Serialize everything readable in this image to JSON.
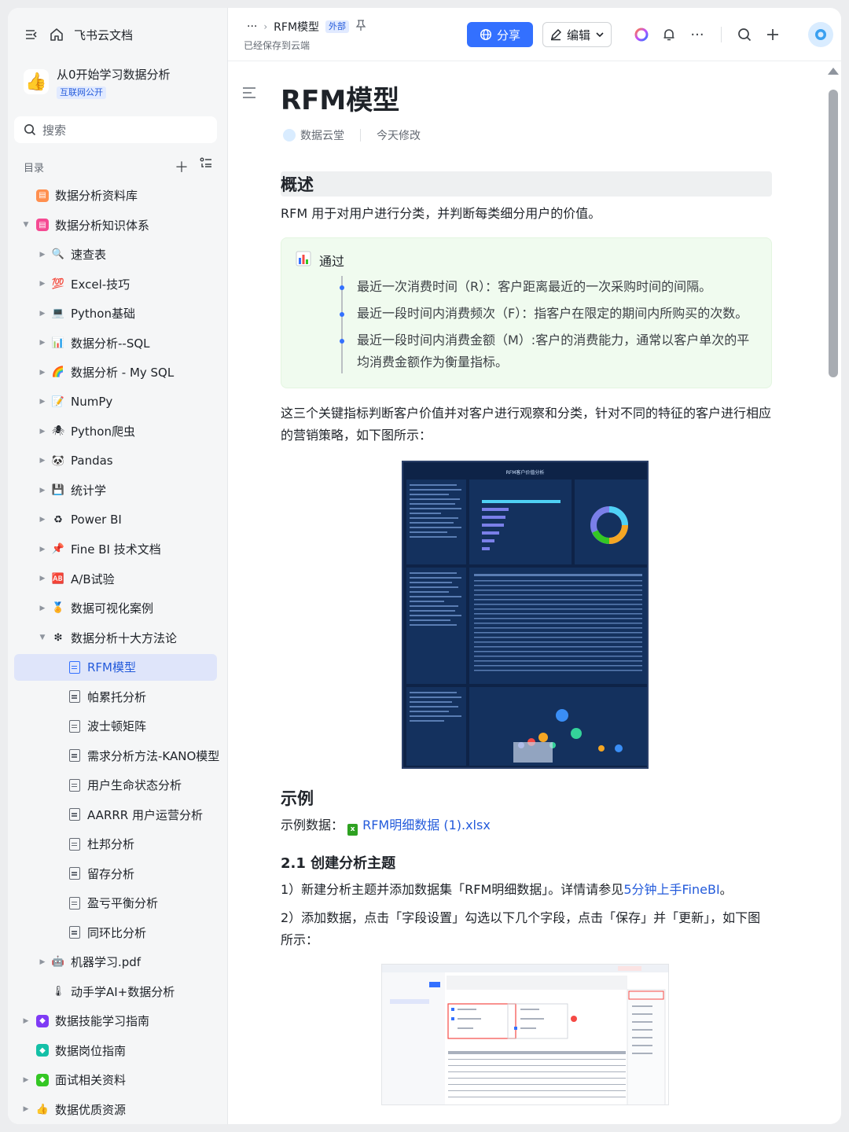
{
  "sidebar": {
    "home_label": "飞书云文档",
    "space_name": "从0开始学习数据分析",
    "space_badge": "互联网公开",
    "search_placeholder": "搜索",
    "toc_label": "目录",
    "tree": [
      {
        "label": "数据分析资料库",
        "level": 0,
        "arrow": "",
        "icon": "folder-orange-icon",
        "color": "#ff8f4f",
        "glyph": "▤"
      },
      {
        "label": "数据分析知识体系",
        "level": 0,
        "arrow": "▼",
        "icon": "folder-pink-icon",
        "color": "#f54a93",
        "glyph": "▤"
      },
      {
        "label": "速查表",
        "level": 1,
        "arrow": "▶",
        "icon": "magnifier-emoji-icon",
        "glyph": "🔍"
      },
      {
        "label": "Excel-技巧",
        "level": 1,
        "arrow": "▶",
        "icon": "hundred-emoji-icon",
        "glyph": "💯"
      },
      {
        "label": "Python基础",
        "level": 1,
        "arrow": "▶",
        "icon": "computer-emoji-icon",
        "glyph": "💻"
      },
      {
        "label": "数据分析--SQL",
        "level": 1,
        "arrow": "▶",
        "icon": "bar-chart-emoji-icon",
        "glyph": "📊"
      },
      {
        "label": "数据分析 - My SQL",
        "level": 1,
        "arrow": "▶",
        "icon": "rainbow-emoji-icon",
        "glyph": "🌈"
      },
      {
        "label": "NumPy",
        "level": 1,
        "arrow": "▶",
        "icon": "memo-emoji-icon",
        "glyph": "📝"
      },
      {
        "label": "Python爬虫",
        "level": 1,
        "arrow": "▶",
        "icon": "spider-emoji-icon",
        "glyph": "🕷"
      },
      {
        "label": "Pandas",
        "level": 1,
        "arrow": "▶",
        "icon": "panda-emoji-icon",
        "glyph": "🐼"
      },
      {
        "label": "统计学",
        "level": 1,
        "arrow": "▶",
        "icon": "floppy-emoji-icon",
        "glyph": "💾"
      },
      {
        "label": "Power BI",
        "level": 1,
        "arrow": "▶",
        "icon": "recycle-emoji-icon",
        "glyph": "♻"
      },
      {
        "label": "Fine BI 技术文档",
        "level": 1,
        "arrow": "▶",
        "icon": "pin-emoji-icon",
        "glyph": "📌"
      },
      {
        "label": "A/B试验",
        "level": 1,
        "arrow": "▶",
        "icon": "ab-emoji-icon",
        "glyph": "🆎"
      },
      {
        "label": "数据可视化案例",
        "level": 1,
        "arrow": "▶",
        "icon": "medal-emoji-icon",
        "glyph": "🏅"
      },
      {
        "label": "数据分析十大方法论",
        "level": 1,
        "arrow": "▼",
        "icon": "sparkle-emoji-icon",
        "glyph": "❇"
      },
      {
        "label": "RFM模型",
        "level": 2,
        "arrow": "",
        "icon": "doc-icon",
        "active": true
      },
      {
        "label": "帕累托分析",
        "level": 2,
        "arrow": "",
        "icon": "doc-icon"
      },
      {
        "label": "波士顿矩阵",
        "level": 2,
        "arrow": "",
        "icon": "doc-icon"
      },
      {
        "label": "需求分析方法-KANO模型",
        "level": 2,
        "arrow": "",
        "icon": "doc-icon"
      },
      {
        "label": "用户生命状态分析",
        "level": 2,
        "arrow": "",
        "icon": "doc-icon"
      },
      {
        "label": "AARRR 用户运营分析",
        "level": 2,
        "arrow": "",
        "icon": "doc-icon"
      },
      {
        "label": "杜邦分析",
        "level": 2,
        "arrow": "",
        "icon": "doc-icon"
      },
      {
        "label": "留存分析",
        "level": 2,
        "arrow": "",
        "icon": "doc-icon"
      },
      {
        "label": "盈亏平衡分析",
        "level": 2,
        "arrow": "",
        "icon": "doc-icon"
      },
      {
        "label": "同环比分析",
        "level": 2,
        "arrow": "",
        "icon": "doc-icon"
      },
      {
        "label": "机器学习.pdf",
        "level": 1,
        "arrow": "▶",
        "icon": "robot-emoji-icon",
        "glyph": "🤖"
      },
      {
        "label": "动手学AI+数据分析",
        "level": 1,
        "arrow": "",
        "icon": "thermometer-emoji-icon",
        "glyph": "🌡"
      },
      {
        "label": "数据技能学习指南",
        "level": 0,
        "arrow": "▶",
        "icon": "folder-purple-icon",
        "color": "#7f3bf5",
        "glyph": "◆"
      },
      {
        "label": "数据岗位指南",
        "level": 0,
        "arrow": "",
        "icon": "folder-teal-icon",
        "color": "#14c0a7",
        "glyph": "◆"
      },
      {
        "label": "面试相关资料",
        "level": 0,
        "arrow": "▶",
        "icon": "folder-green-icon",
        "color": "#34c724",
        "glyph": "◆"
      },
      {
        "label": "数据优质资源",
        "level": 0,
        "arrow": "▶",
        "icon": "thumbs-up-emoji-icon",
        "glyph": "👍"
      }
    ]
  },
  "header": {
    "more_label": "···",
    "doc_name": "RFM模型",
    "ext_tag": "外部",
    "saved_status": "已经保存到云端",
    "share_label": "分享",
    "edit_label": "编辑"
  },
  "doc": {
    "title": "RFM模型",
    "author": "数据云堂",
    "modified": "今天修改",
    "section_overview": "概述",
    "intro": "RFM 用于对用户进行分类，并判断每类细分用户的价值。",
    "callout_title": "通过",
    "callout_items": [
      "最近一次消费时间（R）：客户距离最近的一次采购时间的间隔。",
      "最近一段时间内消费频次（F）：指客户在限定的期间内所购买的次数。",
      "最近一段时间内消费金额（M）:客户的消费能力，通常以客户单次的平均消费金额作为衡量指标。"
    ],
    "para2": "这三个关键指标判断客户价值并对客户进行观察和分类，针对不同的特征的客户进行相应的营销策略，如下图所示：",
    "fig1_title": "RFM客户价值分析",
    "section_example": "示例",
    "example_label": "示例数据：",
    "example_file": "RFM明细数据 (1).xlsx",
    "h3": "2.1 创建分析主题",
    "step1_a": "1）新建分析主题并添加数据集「RFM明细数据」。详情请参见",
    "step1_link": "5分钟上手FineBI",
    "step1_b": "。",
    "step2": "2）添加数据，点击「字段设置」勾选以下几个字段，点击「保存」并「更新」，如下图所示："
  },
  "colors": {
    "accent": "#3370ff",
    "link": "#245bdb",
    "callout_bg": "#f0fbef",
    "dashboard_bg": "#0e2347"
  }
}
